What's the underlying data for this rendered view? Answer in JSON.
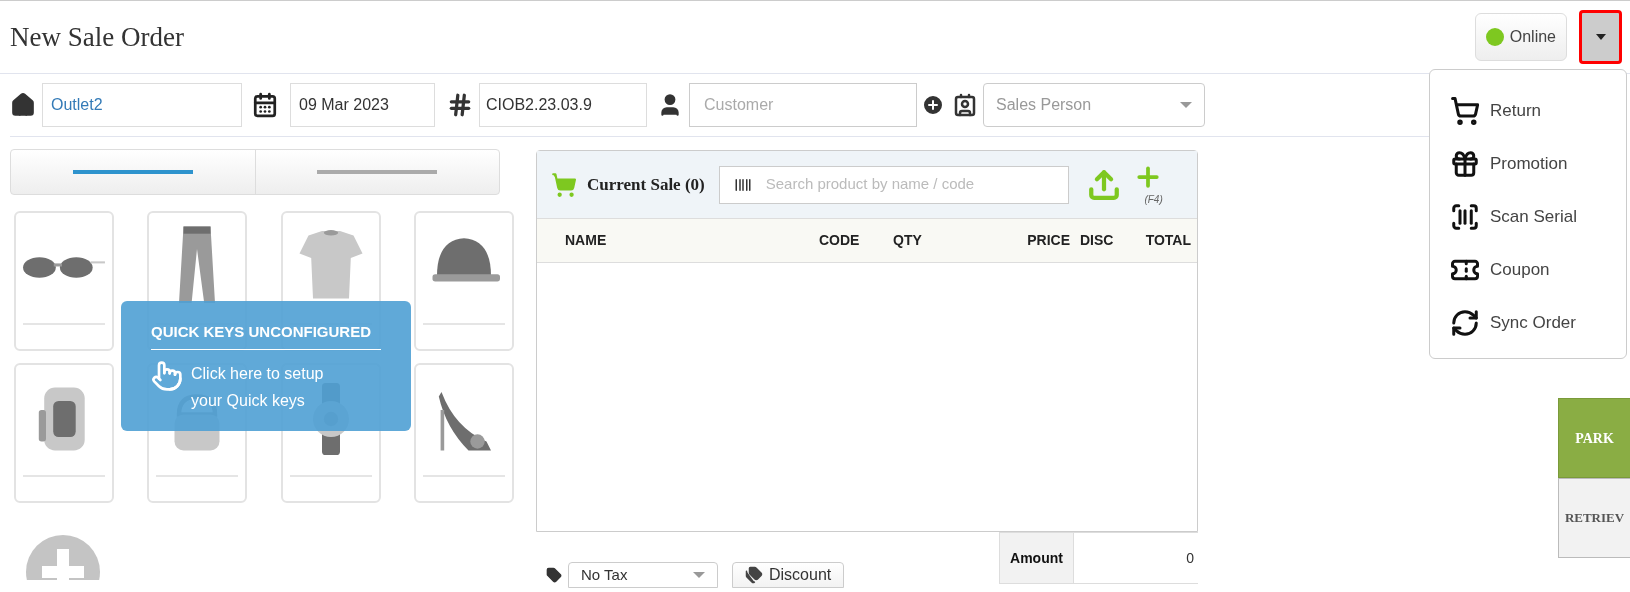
{
  "header": {
    "title": "New Sale Order",
    "connection": {
      "label": "Online",
      "online": true
    },
    "menu_button": {
      "open": true
    }
  },
  "order_fields": {
    "outlet": "Outlet2",
    "date": "09 Mar 2023",
    "number": "CIOB2.23.03.9",
    "customer": {
      "placeholder": "Customer"
    },
    "sales_person": {
      "placeholder": "Sales Person"
    }
  },
  "quick_keys": {
    "tabs": [
      {
        "selected": true
      },
      {
        "selected": false
      }
    ],
    "notice": {
      "title": "QUICK KEYS UNCONFIGURED",
      "text": "Click here to setup your Quick keys"
    }
  },
  "current_sale": {
    "title": "Current Sale (0)",
    "search": {
      "placeholder": "Search product by name / code"
    },
    "add_shortcut": "(F4)",
    "columns": [
      "NAME",
      "CODE",
      "QTY",
      "PRICE",
      "DISC",
      "TOTAL"
    ],
    "amount": {
      "label": "Amount",
      "value": "0"
    },
    "tax": {
      "value": "No Tax"
    },
    "discount_button": "Discount"
  },
  "menu": {
    "items": [
      {
        "label": "Return"
      },
      {
        "label": "Promotion"
      },
      {
        "label": "Scan Serial"
      },
      {
        "label": "Coupon"
      },
      {
        "label": "Sync Order"
      }
    ]
  },
  "side_buttons": [
    {
      "label": "PARK",
      "kind": "primary"
    },
    {
      "label": "RETRIEV",
      "kind": "secondary"
    }
  ]
}
